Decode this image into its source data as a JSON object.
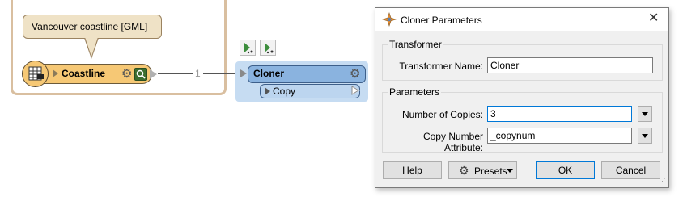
{
  "canvas": {
    "annotation_text": "Vancouver coastline [GML]",
    "reader_name": "Coastline",
    "connection_count": "1",
    "transformer_name": "Cloner",
    "output_port": "Copy"
  },
  "dialog": {
    "title": "Cloner Parameters",
    "group_transformer": "Transformer",
    "transformer_name_label": "Transformer Name:",
    "transformer_name_value": "Cloner",
    "group_parameters": "Parameters",
    "copies_label": "Number of Copies:",
    "copies_value": "3",
    "attr_label": "Copy Number Attribute:",
    "attr_value": "_copynum",
    "help_label": "Help",
    "presets_label": "Presets",
    "ok_label": "OK",
    "cancel_label": "Cancel"
  }
}
